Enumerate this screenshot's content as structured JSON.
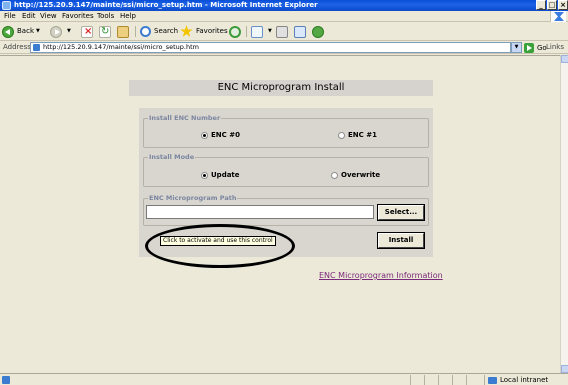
{
  "window": {
    "title": "http://125.20.9.147/mainte/ssi/micro_setup.htm - Microsoft Internet Explorer",
    "minimize_glyph": "_",
    "maximize_glyph": "□",
    "close_glyph": "×"
  },
  "menu": {
    "items": [
      "File",
      "Edit",
      "View",
      "Favorites",
      "Tools",
      "Help"
    ]
  },
  "toolbar": {
    "back_label": "Back",
    "search_label": "Search",
    "favorites_label": "Favorites"
  },
  "address": {
    "label": "Address",
    "url": "http://125.20.9.147/mainte/ssi/micro_setup.htm",
    "go_label": "Go",
    "links_label": "Links"
  },
  "page": {
    "title": "ENC Microprogram Install",
    "enc_group": {
      "legend": "Install ENC Number",
      "option0": "ENC #0",
      "option1": "ENC #1",
      "selected": "ENC #0"
    },
    "mode_group": {
      "legend": "Install Mode",
      "option_update": "Update",
      "option_overwrite": "Overwrite",
      "selected": "Update"
    },
    "path_group": {
      "legend": "ENC Microprogram Path",
      "value": "",
      "select_label": "Select..."
    },
    "install_label": "Install",
    "tooltip": "Click to activate and use this control",
    "info_link": "ENC Microprogram Information"
  },
  "status": {
    "zone_label": "Local intranet"
  },
  "colors": {
    "titlebar": "#0a4fd6",
    "legend_text": "#7a86a0",
    "panel_bg": "#d9d6cf",
    "link": "#7a2a7a",
    "tooltip_bg": "#ffffe1"
  }
}
